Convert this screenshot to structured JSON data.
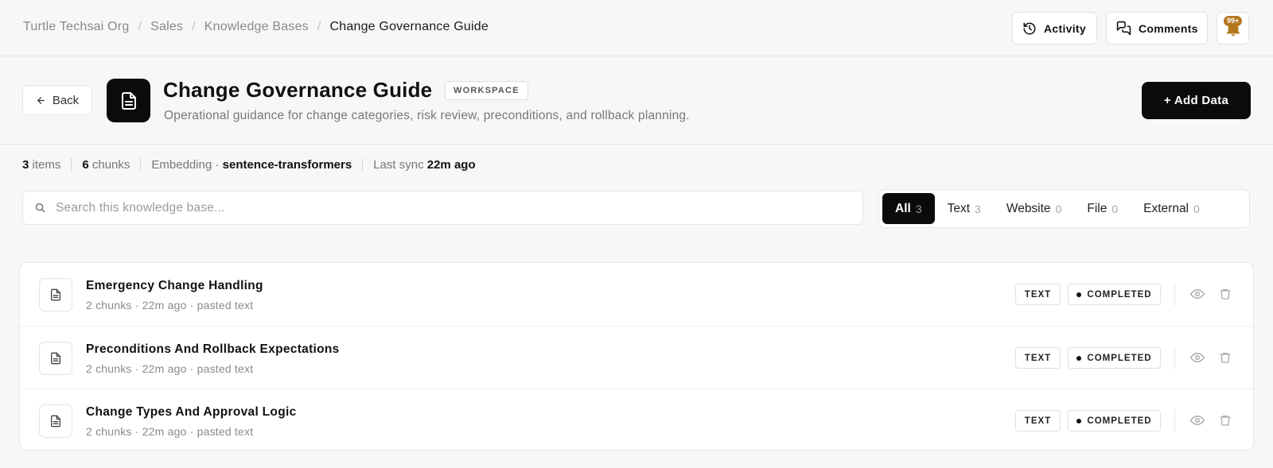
{
  "breadcrumb": {
    "items": [
      "Turtle Techsai Org",
      "Sales",
      "Knowledge Bases"
    ],
    "current": "Change Governance Guide"
  },
  "top_actions": {
    "activity_label": "Activity",
    "comments_label": "Comments",
    "notification_badge": "99+"
  },
  "header": {
    "back_label": "Back",
    "title": "Change Governance Guide",
    "badge": "WORKSPACE",
    "description": "Operational guidance for change categories, risk review, preconditions, and rollback planning.",
    "add_button": "+ Add Data"
  },
  "stats": {
    "items_count": "3",
    "items_label": "items",
    "chunks_count": "6",
    "chunks_label": "chunks",
    "embedding_label": "Embedding ·",
    "embedding_value": "sentence-transformers",
    "sync_label": "Last sync",
    "sync_value": "22m ago"
  },
  "search": {
    "placeholder": "Search this knowledge base...",
    "value": ""
  },
  "filters": [
    {
      "label": "All",
      "count": "3",
      "active": true
    },
    {
      "label": "Text",
      "count": "3",
      "active": false
    },
    {
      "label": "Website",
      "count": "0",
      "active": false
    },
    {
      "label": "File",
      "count": "0",
      "active": false
    },
    {
      "label": "External",
      "count": "0",
      "active": false
    }
  ],
  "items": [
    {
      "title": "Emergency Change Handling",
      "meta": "2 chunks · 22m ago · pasted text",
      "type": "TEXT",
      "status": "COMPLETED"
    },
    {
      "title": "Preconditions And Rollback Expectations",
      "meta": "2 chunks · 22m ago · pasted text",
      "type": "TEXT",
      "status": "COMPLETED"
    },
    {
      "title": "Change Types And Approval Logic",
      "meta": "2 chunks · 22m ago · pasted text",
      "type": "TEXT",
      "status": "COMPLETED"
    }
  ],
  "icons": {
    "activity": "history-icon",
    "comments": "comments-icon",
    "notifications": "bell-icon",
    "back": "arrow-left-icon",
    "document": "document-icon",
    "search": "search-icon",
    "view": "eye-icon",
    "delete": "trash-icon"
  },
  "colors": {
    "primary": "#0b0b0b",
    "background": "#f7f7f7",
    "notification": "#b4761c"
  }
}
